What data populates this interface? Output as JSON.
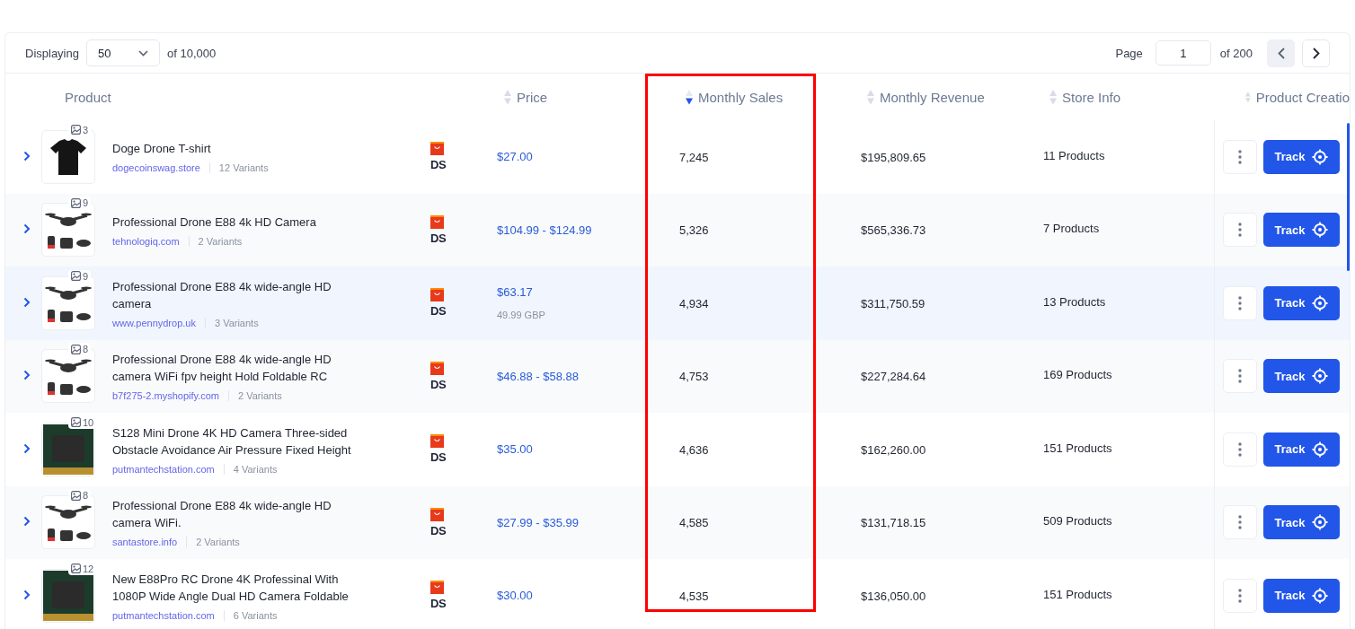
{
  "toolbar": {
    "displaying_label": "Displaying",
    "page_size": "50",
    "total": "of 10,000",
    "page_label": "Page",
    "page": "1",
    "page_total": "of 200",
    "prev_disabled": true,
    "next_disabled": false
  },
  "columns": [
    {
      "label": "Product",
      "sortable": false,
      "highlighted": false
    },
    {
      "label": "Price",
      "sortable": true,
      "sorted": false,
      "highlighted": false
    },
    {
      "label": "Monthly Sales",
      "sortable": true,
      "sorted": true,
      "highlighted": true
    },
    {
      "label": "Monthly Revenue",
      "sortable": true,
      "sorted": false,
      "highlighted": false
    },
    {
      "label": "Store Info",
      "sortable": true,
      "sorted": false,
      "highlighted": false
    },
    {
      "label": "Product Creatio",
      "sortable": true,
      "sorted": false,
      "highlighted": false
    }
  ],
  "rows": [
    {
      "selected": false,
      "image_count": "3",
      "title": "Doge Drone T-shirt",
      "store": "dogecoinswag.store",
      "variants": "12 Variants",
      "platform": "DS",
      "price": "$27.00",
      "price_note": null,
      "sales": "7,245",
      "revenue": "$195,809.65",
      "store_info": "11 Products",
      "action": "Track"
    },
    {
      "selected": false,
      "image_count": "9",
      "title": "Professional Drone E88 4k HD Camera",
      "store": "tehnologiq.com",
      "variants": "2 Variants",
      "platform": "DS",
      "price": "$104.99 - $124.99",
      "price_note": null,
      "sales": "5,326",
      "revenue": "$565,336.73",
      "store_info": "7 Products",
      "action": "Track"
    },
    {
      "selected": true,
      "image_count": "9",
      "title": "Professional Drone E88 4k wide-angle HD camera",
      "store": "www.pennydrop.uk",
      "variants": "3 Variants",
      "platform": "DS",
      "price": "$63.17",
      "price_note": "49.99 GBP",
      "sales": "4,934",
      "revenue": "$311,750.59",
      "store_info": "13 Products",
      "action": "Track"
    },
    {
      "selected": false,
      "image_count": "8",
      "title": "Professional Drone E88 4k wide-angle HD camera WiFi fpv height Hold Foldable RC",
      "store": "b7f275-2.myshopify.com",
      "variants": "2 Variants",
      "platform": "DS",
      "price": "$46.88 - $58.88",
      "price_note": null,
      "sales": "4,753",
      "revenue": "$227,284.64",
      "store_info": "169 Products",
      "action": "Track"
    },
    {
      "selected": false,
      "image_count": "10",
      "title": "S128 Mini Drone 4K HD Camera Three-sided Obstacle Avoidance Air Pressure Fixed Height",
      "store": "putmantechstation.com",
      "variants": "4 Variants",
      "platform": "DS",
      "price": "$35.00",
      "price_note": null,
      "sales": "4,636",
      "revenue": "$162,260.00",
      "store_info": "151 Products",
      "action": "Track"
    },
    {
      "selected": false,
      "image_count": "8",
      "title": "Professional Drone E88 4k wide-angle HD camera WiFi.",
      "store": "santastore.info",
      "variants": "2 Variants",
      "platform": "DS",
      "price": "$27.99 - $35.99",
      "price_note": null,
      "sales": "4,585",
      "revenue": "$131,718.15",
      "store_info": "509 Products",
      "action": "Track"
    },
    {
      "selected": false,
      "image_count": "12",
      "title": "New E88Pro RC Drone 4K Professinal With 1080P Wide Angle Dual HD Camera Foldable",
      "store": "putmantechstation.com",
      "variants": "6 Variants",
      "platform": "DS",
      "price": "$30.00",
      "price_note": null,
      "sales": "4,535",
      "revenue": "$136,050.00",
      "store_info": "151 Products",
      "action": "Track"
    }
  ]
}
